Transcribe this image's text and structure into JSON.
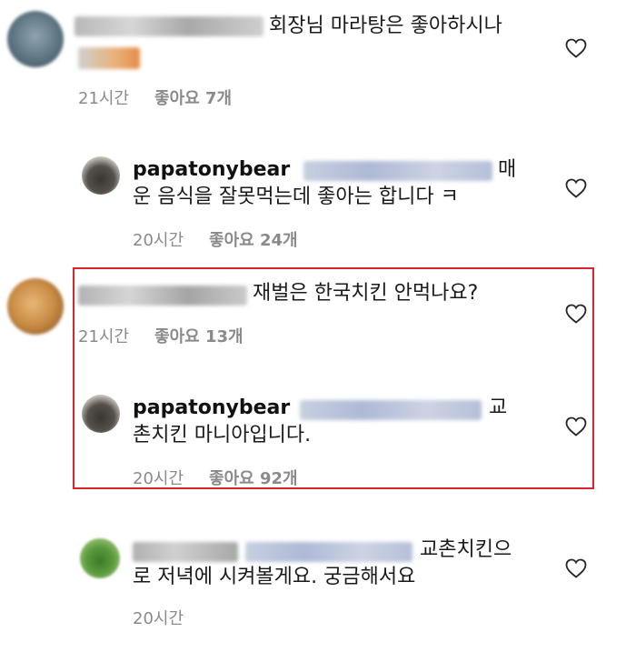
{
  "comments": [
    {
      "id": "c1",
      "text_line1": "회장님 마라탕은 좋아하시나",
      "time": "21시간",
      "likes": "좋아요 7개"
    },
    {
      "id": "r1",
      "username": "papatonybear",
      "text_line1_tail": "매",
      "text_line2": "운 음식을 잘못먹는데 좋아는 합니다 ㅋ",
      "time": "20시간",
      "likes": "좋아요 24개"
    },
    {
      "id": "c2",
      "text_line1": "재벌은 한국치킨 안먹나요?",
      "time": "21시간",
      "likes": "좋아요 13개"
    },
    {
      "id": "r2",
      "username": "papatonybear",
      "text_line1_tail": "교",
      "text_line2": "촌치킨 마니아입니다.",
      "time": "20시간",
      "likes": "좋아요 92개"
    },
    {
      "id": "c3",
      "text_line1_tail": "교촌치킨으",
      "text_line2": "로 저녁에 시켜볼게요. 궁금해서요",
      "time": "20시간"
    }
  ],
  "icons": {
    "like": "heart-outline-icon"
  },
  "colors": {
    "highlight": "#d9252b",
    "meta": "#8a8a8a"
  }
}
